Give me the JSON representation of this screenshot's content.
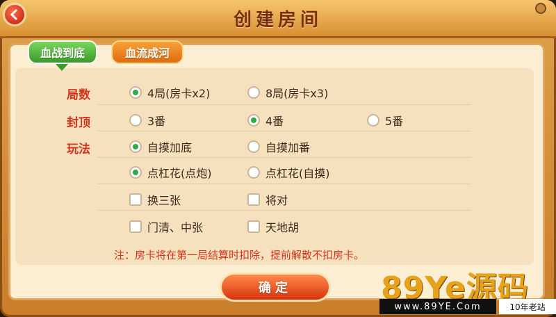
{
  "window": {
    "title": "创建房间"
  },
  "tabs": [
    {
      "label": "血战到底",
      "active": true
    },
    {
      "label": "血流成河",
      "active": false
    }
  ],
  "rows": {
    "rounds": {
      "label": "局数",
      "options": [
        {
          "label": "4局(房卡x2)",
          "checked": true
        },
        {
          "label": "8局(房卡x3)",
          "checked": false
        }
      ]
    },
    "cap": {
      "label": "封顶",
      "options": [
        {
          "label": "3番",
          "checked": false
        },
        {
          "label": "4番",
          "checked": true
        },
        {
          "label": "5番",
          "checked": false
        }
      ]
    },
    "rules": {
      "label": "玩法",
      "radio_rows": [
        [
          {
            "label": "自摸加底",
            "checked": true
          },
          {
            "label": "自摸加番",
            "checked": false
          }
        ],
        [
          {
            "label": "点杠花(点炮)",
            "checked": true
          },
          {
            "label": "点杠花(自摸)",
            "checked": false
          }
        ]
      ],
      "check_rows": [
        [
          {
            "label": "换三张",
            "checked": false
          },
          {
            "label": "将对",
            "checked": false
          }
        ],
        [
          {
            "label": "门清、中张",
            "checked": false
          },
          {
            "label": "天地胡",
            "checked": false
          }
        ]
      ]
    }
  },
  "note": "注：房卡将在第一局结算时扣除，提前解散不扣房卡。",
  "confirm_label": "确定",
  "watermark": {
    "main": "89Ye源码",
    "url": "www.89YE.Com",
    "side": "10年老站"
  },
  "colors": {
    "accent_red": "#d7331a",
    "selected_green": "#2eaa4a",
    "tab_green": "#3a9a2a",
    "tab_orange": "#e06a12"
  }
}
